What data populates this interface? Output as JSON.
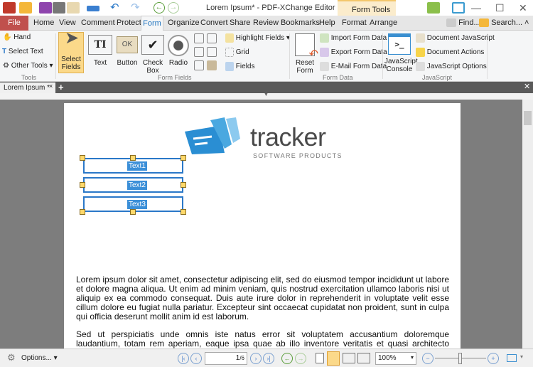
{
  "window": {
    "title": "Lorem Ipsum* - PDF-XChange Editor",
    "context_tab": "Form Tools"
  },
  "menu": {
    "file": "File",
    "tabs": [
      "Home",
      "View",
      "Comment",
      "Protect",
      "Form",
      "Organize",
      "Convert",
      "Share",
      "Review",
      "Bookmarks",
      "Help",
      "Format",
      "Arrange"
    ],
    "find": "Find...",
    "search": "Search..."
  },
  "ribbon": {
    "tools": {
      "label": "Tools",
      "hand": "Hand",
      "select_text": "Select Text",
      "other_tools": "Other Tools"
    },
    "form_fields": {
      "label": "Form Fields",
      "select_fields": "Select Fields",
      "text": "Text",
      "button": "Button",
      "check_box": "Check Box",
      "radio": "Radio",
      "highlight_fields": "Highlight Fields",
      "grid": "Grid",
      "fields": "Fields"
    },
    "form_data": {
      "label": "Form Data",
      "reset_form": "Reset Form",
      "import": "Import Form Data",
      "export": "Export Form Data",
      "email": "E-Mail Form Data"
    },
    "javascript": {
      "label": "JavaScript",
      "console": "JavaScript Console",
      "document_js": "Document JavaScript",
      "document_actions": "Document Actions",
      "js_options": "JavaScript Options"
    }
  },
  "document": {
    "tab": "Lorem Ipsum *",
    "logo": {
      "word": "tracker",
      "sub": "SOFTWARE PRODUCTS"
    },
    "fields": [
      "Text1",
      "Text2",
      "Text3"
    ],
    "paragraphs": [
      "Lorem ipsum dolor sit amet, consectetur adipiscing elit, sed do eiusmod tempor incididunt ut labore et dolore magna aliqua. Ut enim ad minim veniam, quis nostrud exercitation ullamco laboris nisi ut aliquip ex ea commodo consequat. Duis aute irure dolor in reprehenderit in voluptate velit esse cillum dolore eu fugiat nulla pariatur. Excepteur sint occaecat cupidatat non proident, sunt in culpa qui officia deserunt mollit anim id est laborum.",
      "Sed ut perspiciatis unde omnis iste natus error sit voluptatem accusantium doloremque laudantium, totam rem aperiam, eaque ipsa quae ab illo inventore veritatis et quasi architecto beatae vitae dicta sunt"
    ]
  },
  "status": {
    "options": "Options...",
    "page": "1",
    "page_total": "/6",
    "zoom": "100%",
    "zoom_slider_percent": 50
  },
  "colors": {
    "accent": "#1e73be",
    "file_tab": "#c0504d",
    "context": "#fbeccc",
    "field_border": "#2a78c8"
  }
}
